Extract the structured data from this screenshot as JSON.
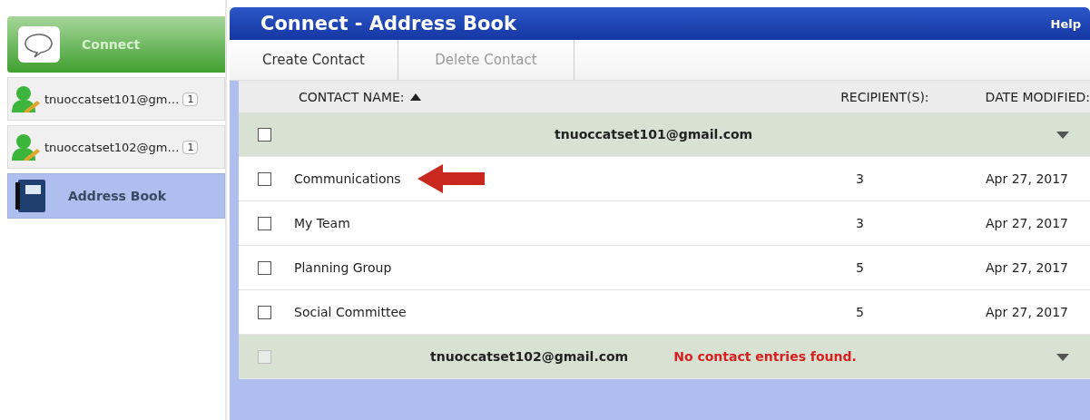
{
  "sidebar": {
    "items": [
      {
        "kind": "app",
        "label": "Connect",
        "selected": false
      },
      {
        "kind": "account",
        "label": "tnuoccatset101@gm…",
        "badge": "1",
        "selected": false
      },
      {
        "kind": "account",
        "label": "tnuoccatset102@gm…",
        "badge": "1",
        "selected": false
      },
      {
        "kind": "book",
        "label": "Address Book",
        "selected": true
      }
    ]
  },
  "window": {
    "title": "Connect - Address Book",
    "help": "Help"
  },
  "toolbar": [
    {
      "label": "Create Contact",
      "disabled": false
    },
    {
      "label": "Delete Contact",
      "disabled": true
    }
  ],
  "table": {
    "columns": [
      "CONTACT NAME:",
      "RECIPIENT(S):",
      "DATE MODIFIED:"
    ],
    "sort_ascending": true,
    "groups": [
      {
        "email": "tnuoccatset101@gmail.com",
        "disabled": false,
        "checked": false,
        "contacts": [
          {
            "name": "Communications",
            "recipients": "3",
            "date": "Apr 27, 2017",
            "checked": false,
            "marked": true
          },
          {
            "name": "My Team",
            "recipients": "3",
            "date": "Apr 27, 2017",
            "checked": false,
            "marked": false
          },
          {
            "name": "Planning Group",
            "recipients": "5",
            "date": "Apr 27, 2017",
            "checked": false,
            "marked": false
          },
          {
            "name": "Social Committee",
            "recipients": "5",
            "date": "Apr 27, 2017",
            "checked": false,
            "marked": false
          }
        ]
      },
      {
        "email": "tnuoccatset102@gmail.com",
        "disabled": true,
        "checked": false,
        "message": "No contact entries found."
      }
    ]
  }
}
